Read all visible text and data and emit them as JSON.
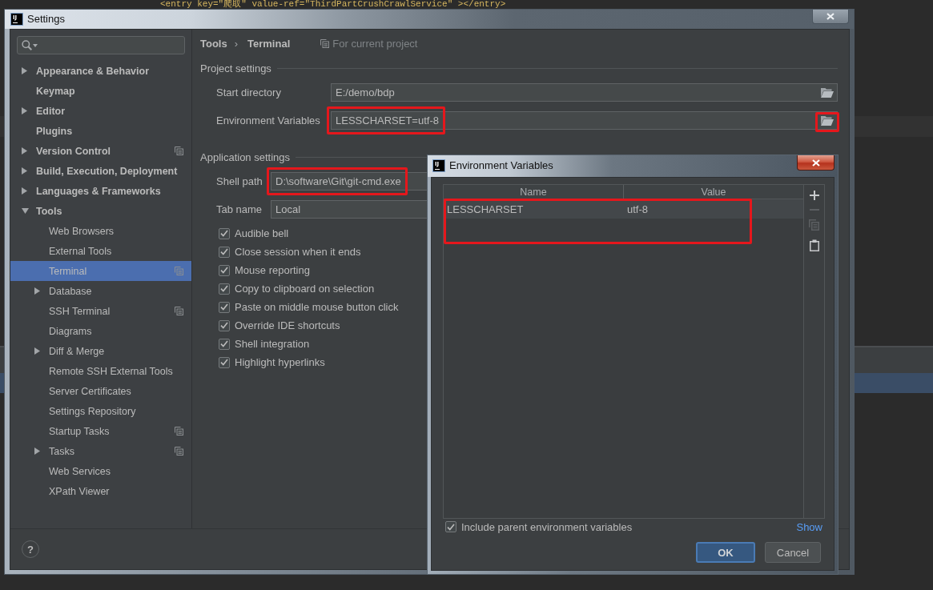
{
  "editor": {
    "code_line": "<entry key=\"爬取\" value-ref=\"ThirdPartCrushCrawlService\" ></entry>"
  },
  "window": {
    "logo": "IJ",
    "title": "Settings"
  },
  "sidebar": {
    "items": [
      {
        "label": "Appearance & Behavior",
        "expanded": false,
        "selected": false,
        "project": false
      },
      {
        "label": "Keymap",
        "selected": false,
        "project": false
      },
      {
        "label": "Editor",
        "expanded": false,
        "selected": false,
        "project": false
      },
      {
        "label": "Plugins",
        "selected": false,
        "project": false
      },
      {
        "label": "Version Control",
        "expanded": false,
        "selected": false,
        "project": true
      },
      {
        "label": "Build, Execution, Deployment",
        "expanded": false,
        "selected": false,
        "project": false
      },
      {
        "label": "Languages & Frameworks",
        "expanded": false,
        "selected": false,
        "project": false
      },
      {
        "label": "Tools",
        "expanded": true,
        "selected": false,
        "project": false,
        "children": [
          {
            "label": "Web Browsers",
            "selected": false,
            "project": false
          },
          {
            "label": "External Tools",
            "selected": false,
            "project": false
          },
          {
            "label": "Terminal",
            "selected": true,
            "project": true
          },
          {
            "label": "Database",
            "expanded": false,
            "selected": false,
            "project": false
          },
          {
            "label": "SSH Terminal",
            "selected": false,
            "project": true
          },
          {
            "label": "Diagrams",
            "selected": false,
            "project": false
          },
          {
            "label": "Diff & Merge",
            "expanded": false,
            "selected": false,
            "project": false
          },
          {
            "label": "Remote SSH External Tools",
            "selected": false,
            "project": false
          },
          {
            "label": "Server Certificates",
            "selected": false,
            "project": false
          },
          {
            "label": "Settings Repository",
            "selected": false,
            "project": false
          },
          {
            "label": "Startup Tasks",
            "selected": false,
            "project": true
          },
          {
            "label": "Tasks",
            "expanded": false,
            "selected": false,
            "project": true
          },
          {
            "label": "Web Services",
            "selected": false,
            "project": false
          },
          {
            "label": "XPath Viewer",
            "selected": false,
            "project": false
          }
        ]
      }
    ]
  },
  "breadcrumb": {
    "items": [
      "Tools",
      "Terminal"
    ],
    "separator": "›"
  },
  "scope_hint": "For current project",
  "project_settings": {
    "title": "Project settings",
    "fields": [
      {
        "kind": "browse",
        "label": "Start directory",
        "value": "E:/demo/bdp",
        "highlighted": false,
        "browse_highlighted": false
      },
      {
        "kind": "browse",
        "label": "Environment Variables",
        "value": "LESSCHARSET=utf-8",
        "highlighted": true,
        "browse_highlighted": true
      }
    ]
  },
  "application_settings": {
    "title": "Application settings",
    "fields": [
      {
        "label": "Shell path",
        "value": "D:\\software\\Git\\git-cmd.exe",
        "highlighted": true
      },
      {
        "label": "Tab name",
        "value": "Local",
        "highlighted": false
      }
    ],
    "options": [
      {
        "label": "Audible bell",
        "checked": true
      },
      {
        "label": "Close session when it ends",
        "checked": true
      },
      {
        "label": "Mouse reporting",
        "checked": true
      },
      {
        "label": "Copy to clipboard on selection",
        "checked": true
      },
      {
        "label": "Paste on middle mouse button click",
        "checked": true
      },
      {
        "label": "Override IDE shortcuts",
        "checked": true
      },
      {
        "label": "Shell integration",
        "checked": true
      },
      {
        "label": "Highlight hyperlinks",
        "checked": true
      }
    ]
  },
  "help_button": "?",
  "env_dialog": {
    "logo": "IJ",
    "title": "Environment Variables",
    "table": {
      "columns": [
        "Name",
        "Value"
      ],
      "rows": [
        [
          "LESSCHARSET",
          "utf-8"
        ]
      ],
      "highlighted": true
    },
    "toolbar": [
      {
        "kind": "add",
        "disabled": false
      },
      {
        "kind": "remove",
        "disabled": true
      },
      {
        "kind": "copy",
        "disabled": true
      },
      {
        "kind": "paste",
        "disabled": false
      }
    ],
    "include_parent": {
      "label": "Include parent environment variables",
      "checked": true
    },
    "show_link": "Show",
    "buttons": [
      {
        "label": "OK",
        "default": true
      },
      {
        "label": "Cancel",
        "default": false
      }
    ]
  }
}
